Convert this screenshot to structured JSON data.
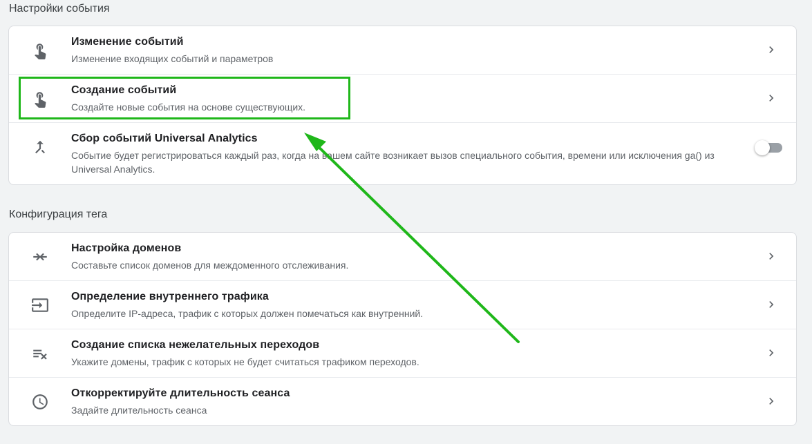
{
  "sections": {
    "event_settings": {
      "heading": "Настройки события",
      "items": [
        {
          "title": "Изменение событий",
          "desc": "Изменение входящих событий и параметров"
        },
        {
          "title": "Создание событий",
          "desc": "Создайте новые события на основе существующих."
        },
        {
          "title": "Сбор событий Universal Analytics",
          "desc": "Событие будет регистрироваться каждый раз, когда на вашем сайте возникает вызов специального события, времени или исключения ga() из Universal Analytics.",
          "toggle": "off"
        }
      ]
    },
    "tag_config": {
      "heading": "Конфигурация тега",
      "items": [
        {
          "title": "Настройка доменов",
          "desc": "Составьте список доменов для междоменного отслеживания."
        },
        {
          "title": "Определение внутреннего трафика",
          "desc": "Определите IP-адреса, трафик с которых должен помечаться как внутренний."
        },
        {
          "title": "Создание списка нежелательных переходов",
          "desc": "Укажите домены, трафик с которых не будет считаться трафиком переходов."
        },
        {
          "title": "Откорректируйте длительность сеанса",
          "desc": "Задайте длительность сеанса"
        }
      ]
    }
  },
  "icons": {
    "event_settings": [
      "touch-icon",
      "touch-icon",
      "merge-icon"
    ],
    "tag_config": [
      "compare-arrows-icon",
      "input-icon",
      "playlist-remove-icon",
      "clock-icon"
    ]
  },
  "colors": {
    "highlight": "#1fb71a",
    "background": "#f1f3f4",
    "card": "#ffffff"
  }
}
